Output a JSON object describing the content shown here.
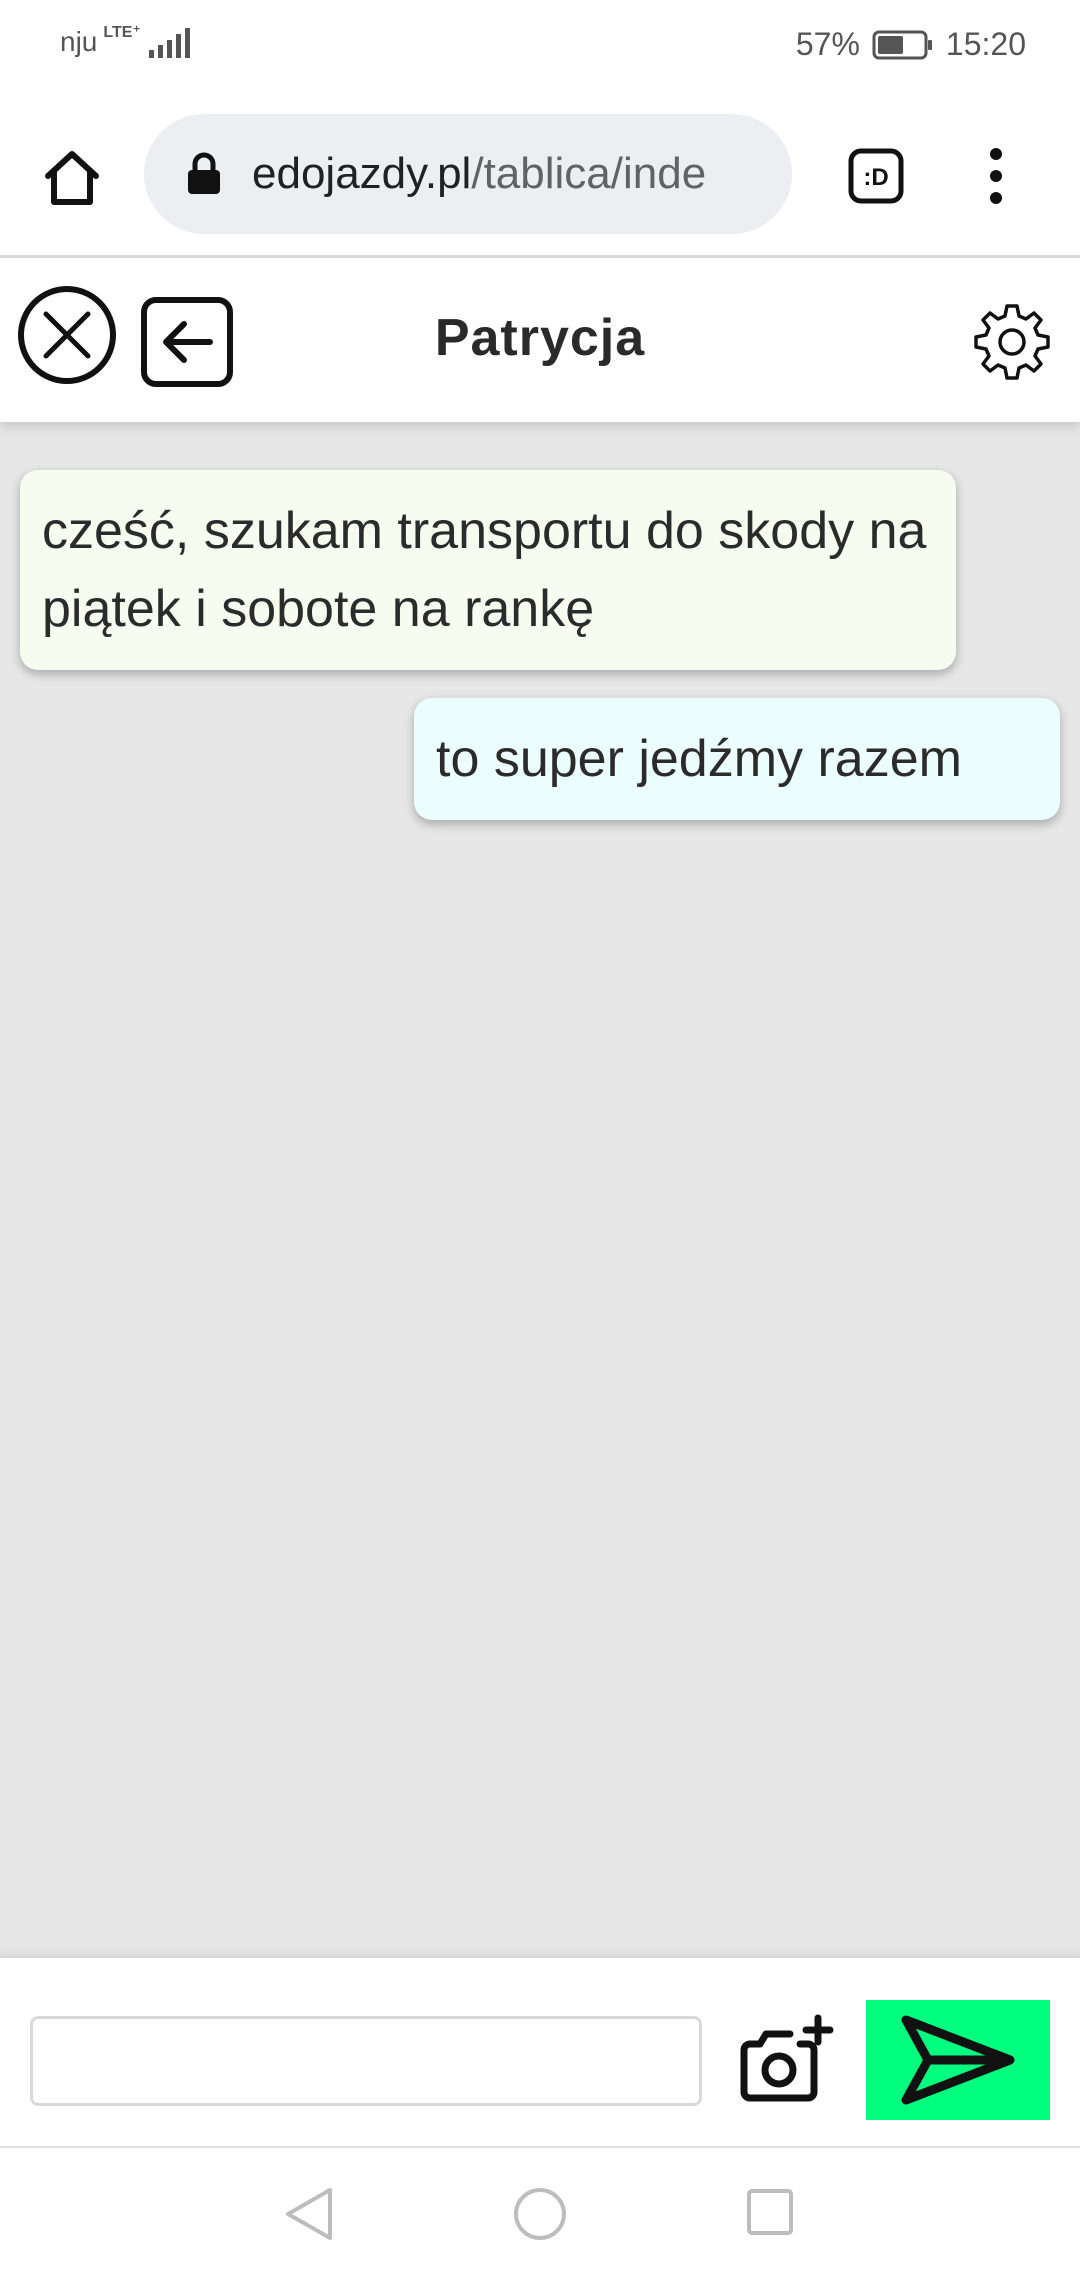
{
  "status_bar": {
    "carrier": "nju",
    "network_type": "LTE⁺",
    "battery_percent": "57%",
    "battery_level": 0.57,
    "time": "15:20"
  },
  "browser": {
    "url_host": "edojazdy.pl",
    "url_path": "/tablica/inde",
    "tab_badge": ":D"
  },
  "chat": {
    "title": "Patrycja",
    "messages": [
      {
        "direction": "incoming",
        "text": "cześć, szukam transportu do skody na piątek i sobote na rankę"
      },
      {
        "direction": "outgoing",
        "text": "to super jedźmy razem"
      }
    ]
  },
  "composer": {
    "input_value": "",
    "input_placeholder": ""
  },
  "colors": {
    "send_button": "#00ff7f",
    "incoming_bubble": "#f6fdf0",
    "outgoing_bubble": "#ecfdfd",
    "chat_background": "#e7e7e7"
  }
}
